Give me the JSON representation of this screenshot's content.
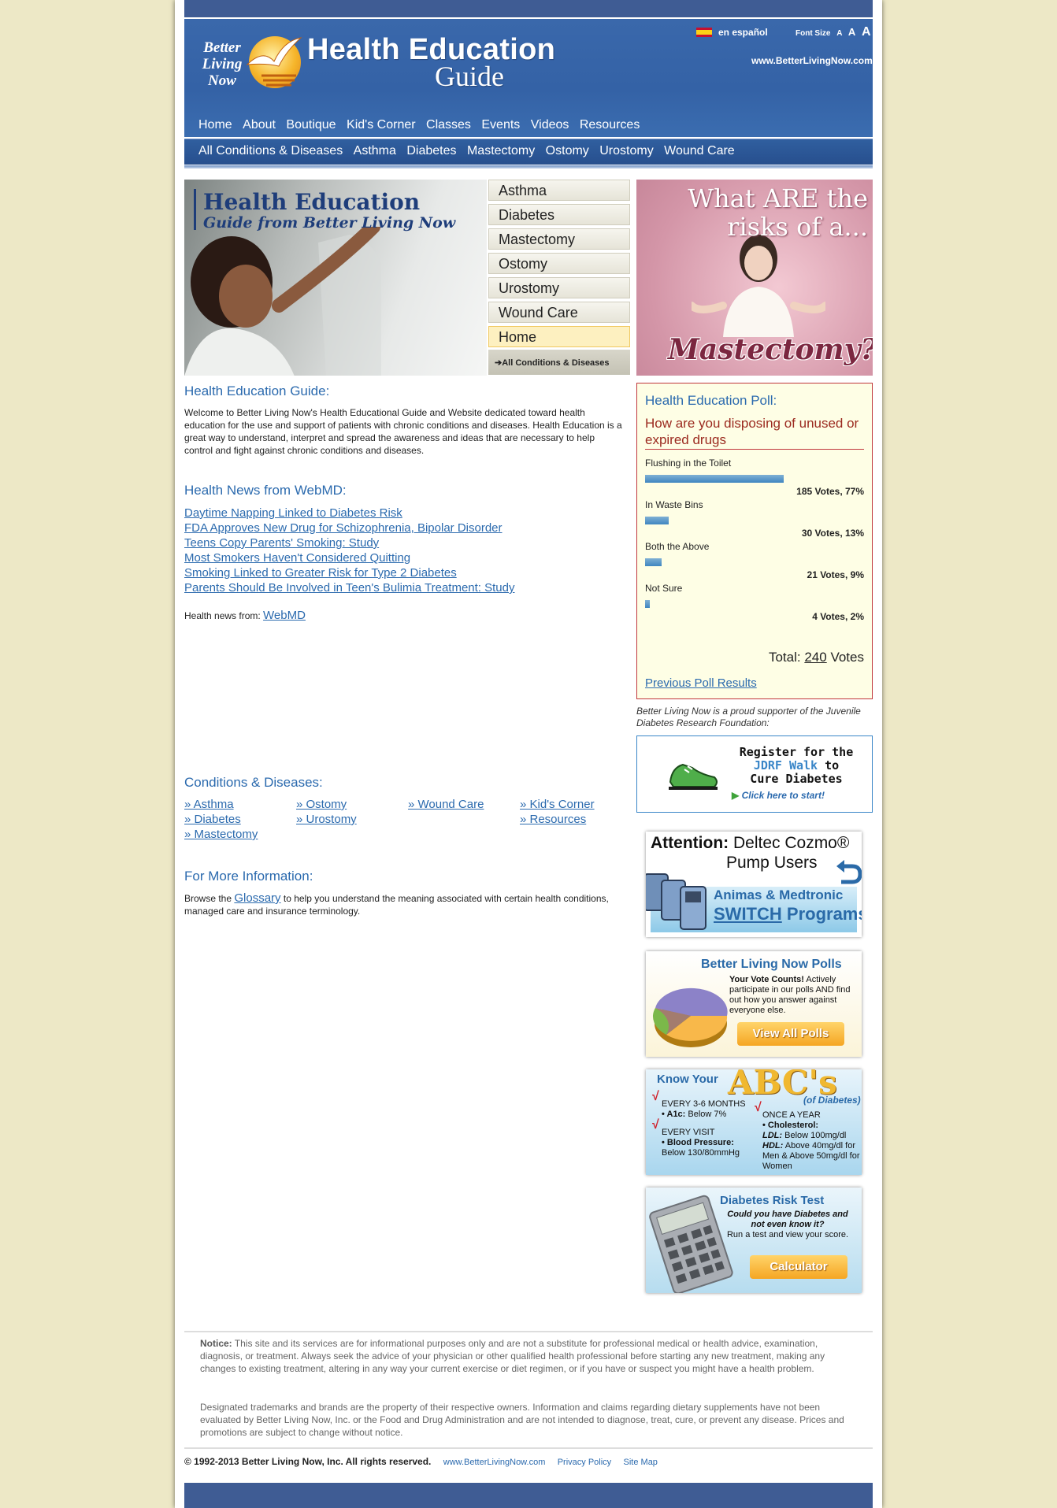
{
  "header": {
    "logo_text": "Better Living Now",
    "title_line1": "Health Education",
    "title_line2": "Guide",
    "language_link": "en español",
    "font_size_label": "Font Size",
    "font_size_options": [
      "A",
      "A",
      "A"
    ],
    "site_url": "www.BetterLivingNow.com"
  },
  "nav_primary": [
    "Home",
    "About",
    "Boutique",
    "Kid's Corner",
    "Classes",
    "Events",
    "Videos",
    "Resources"
  ],
  "nav_secondary": [
    "All Conditions & Diseases",
    "Asthma",
    "Diabetes",
    "Mastectomy",
    "Ostomy",
    "Urostomy",
    "Wound Care"
  ],
  "hero": {
    "title": "Health Education",
    "subtitle": "Guide from Better Living Now"
  },
  "side_menu": {
    "items": [
      "Asthma",
      "Diabetes",
      "Mastectomy",
      "Ostomy",
      "Urostomy",
      "Wound Care",
      "Home"
    ],
    "active": "Home",
    "all_link": "All Conditions & Diseases"
  },
  "promo": {
    "question": "What ARE the risks of a...",
    "word": "Mastectomy?"
  },
  "intro": {
    "heading": "Health Education Guide:",
    "text": "Welcome to Better Living Now's Health Educational Guide and Website dedicated toward health education for the use and support of patients with chronic conditions and diseases. Health Education is a great way to understand, interpret and spread the awareness and ideas that are necessary to help control and fight against chronic conditions and diseases."
  },
  "news": {
    "heading": "Health News from WebMD:",
    "items": [
      "Daytime Napping Linked to Diabetes Risk",
      "FDA Approves New Drug for Schizophrenia, Bipolar Disorder",
      "Teens Copy Parents' Smoking: Study",
      "Most Smokers Haven't Considered Quitting",
      "Smoking Linked to Greater Risk for Type 2 Diabetes",
      "Parents Should Be Involved in Teen's Bulimia Treatment: Study"
    ],
    "source_label": "Health news from:",
    "source_link": "WebMD"
  },
  "conditions": {
    "heading": "Conditions & Diseases:",
    "col1": [
      "» Asthma",
      "» Diabetes",
      "» Mastectomy"
    ],
    "col2": [
      "» Ostomy",
      "» Urostomy"
    ],
    "col3": [
      "» Wound Care"
    ],
    "col4": [
      "» Kid's Corner",
      "» Resources"
    ]
  },
  "more_info": {
    "heading": "For More Information:",
    "text_before": "Browse the",
    "link": "Glossary",
    "text_after": "to help you understand the meaning associated with certain health conditions, managed care and insurance terminology."
  },
  "poll": {
    "title": "Health Education Poll:",
    "question": "How are you disposing of unused or expired drugs",
    "options": [
      {
        "label": "Flushing in the Toilet",
        "votes_text": "185 Votes, 77%",
        "percent": 77
      },
      {
        "label": "In Waste Bins",
        "votes_text": "30 Votes, 13%",
        "percent": 13
      },
      {
        "label": "Both the Above",
        "votes_text": "21 Votes, 9%",
        "percent": 9
      },
      {
        "label": "Not Sure",
        "votes_text": "4 Votes, 2%",
        "percent": 2
      }
    ],
    "total_label": "Total:",
    "total_value": "240",
    "total_suffix": "Votes",
    "previous_link": "Previous Poll Results"
  },
  "jdrf": {
    "note": "Better Living Now is a proud supporter of the Juvenile Diabetes Research Foundation:",
    "line1": "Register for the",
    "line2a": "JDRF Walk",
    "line2b": "to",
    "line3": "Cure Diabetes",
    "cta": "Click here to start!"
  },
  "ads": {
    "pump": {
      "attention": "Attention:",
      "brand": "Deltec Cozmo®",
      "line2": "Pump Users",
      "sub1": "Animas & Medtronic",
      "sub2a": "SWITCH",
      "sub2b": "Programs"
    },
    "polls": {
      "title": "Better Living Now Polls",
      "bold": "Your Vote Counts!",
      "text": "Actively participate in our polls AND find out how you answer against everyone else.",
      "button": "View All Polls"
    },
    "abc": {
      "know": "Know Your",
      "abc": "ABC's",
      "sub": "(of Diabetes)",
      "a_when": "EVERY 3-6 MONTHS",
      "a_label": "• A1c:",
      "a_value": "Below 7%",
      "b_when": "EVERY VISIT",
      "b_label": "• Blood Pressure:",
      "b_value": "Below 130/80mmHg",
      "c_when": "ONCE A YEAR",
      "c_label": "• Cholesterol:",
      "c_ldl": "LDL:",
      "c_ldl_value": "Below 100mg/dl",
      "c_hdl": "HDL:",
      "c_hdl_value": "Above 40mg/dl for Men & Above 50mg/dl for Women"
    },
    "risk": {
      "title": "Diabetes Risk Test",
      "q": "Could you have Diabetes and not even know it?",
      "text": "Run a test and view your score.",
      "button": "Calculator"
    }
  },
  "footer": {
    "notice_label": "Notice:",
    "notice": "This site and its services are for informational purposes only and are not a substitute for professional medical or health advice, examination, diagnosis, or treatment. Always seek the advice of your physician or other qualified health professional before starting any new treatment, making any changes to existing treatment, altering in any way your current exercise or diet regimen, or if you have or suspect you might have a health problem.",
    "disclaimer": "Designated trademarks and brands are the property of their respective owners. Information and claims regarding dietary supplements have not been evaluated by Better Living Now, Inc. or the Food and Drug Administration and are not intended to diagnose, treat, cure, or prevent any disease. Prices and promotions are subject to change without notice.",
    "copyright": "© 1992-2013 Better Living Now, Inc. All rights reserved.",
    "links": [
      "www.BetterLivingNow.com",
      "Privacy Policy",
      "Site Map"
    ]
  },
  "colors": {
    "header_blue": "#3462a6",
    "link_blue": "#2b6aae",
    "poll_red": "#c0373c",
    "page_bg": "#ede8c6"
  }
}
